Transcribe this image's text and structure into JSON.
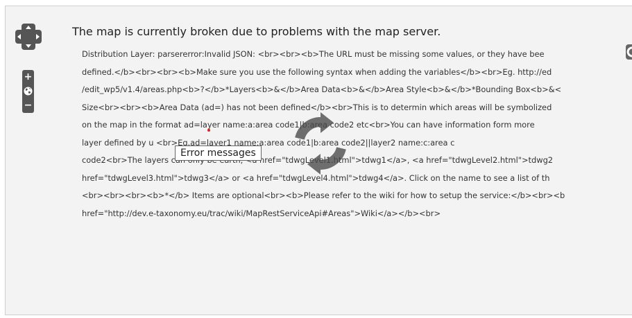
{
  "map": {
    "message_title": "The map is currently broken due to problems with the map server.",
    "error_lines": [
      "Distribution Layer: parsererror:Invalid JSON: <br><br><b>The URL must be missing some values, or they have bee",
      "defined.</b><br><br><b>Make sure you use the following syntax when adding the variables</b><br>Eg. http://ed",
      "/edit_wp5/v1.4/areas.php<b>?</b>*Layers<b>&</b>Area Data<b>&</b>Area Style<b>&</b>*Bounding Box<b>&<",
      "Size<br><br><b>Area Data (ad=) has not been defined</b><br>This is to determin which areas will be symbolized",
      "on the map in the format ad=layer name:a:area code1|b:area code2 etc<br>You can have information form more",
      "layer defined by u                       <br>Eg.ad=layer1 name:a:area code1|b:area code2||layer2 name:c:area c",
      "code2<br>The layers can only be earth, <a href=\"tdwgLevel1.html\">tdwg1</a>, <a href=\"tdwgLevel2.html\">tdwg2",
      "href=\"tdwgLevel3.html\">tdwg3</a> or <a href=\"tdwgLevel4.html\">tdwg4</a>. Click on the name to see a list of th",
      "<br><br><br><b>*</b> Items are optional<br><b>Please refer to the wiki for how to setup the service:</b><br><b",
      "href=\"http://dev.e-taxonomy.eu/trac/wiki/MapRestServiceApi#Areas\">Wiki</a></b><br>"
    ],
    "tooltip": "Error messages",
    "zoom_in_label": "+",
    "zoom_out_label": "−"
  },
  "icons": {
    "pan": "pan-arrows-icon",
    "world": "globe-icon",
    "loader": "refresh-spinner-icon",
    "corner": "layer-switcher-icon"
  },
  "colors": {
    "map_background": "#f3f3f3",
    "control_fill": "#555555",
    "spinner": "#4a4a4a",
    "marker": "#e02020"
  }
}
